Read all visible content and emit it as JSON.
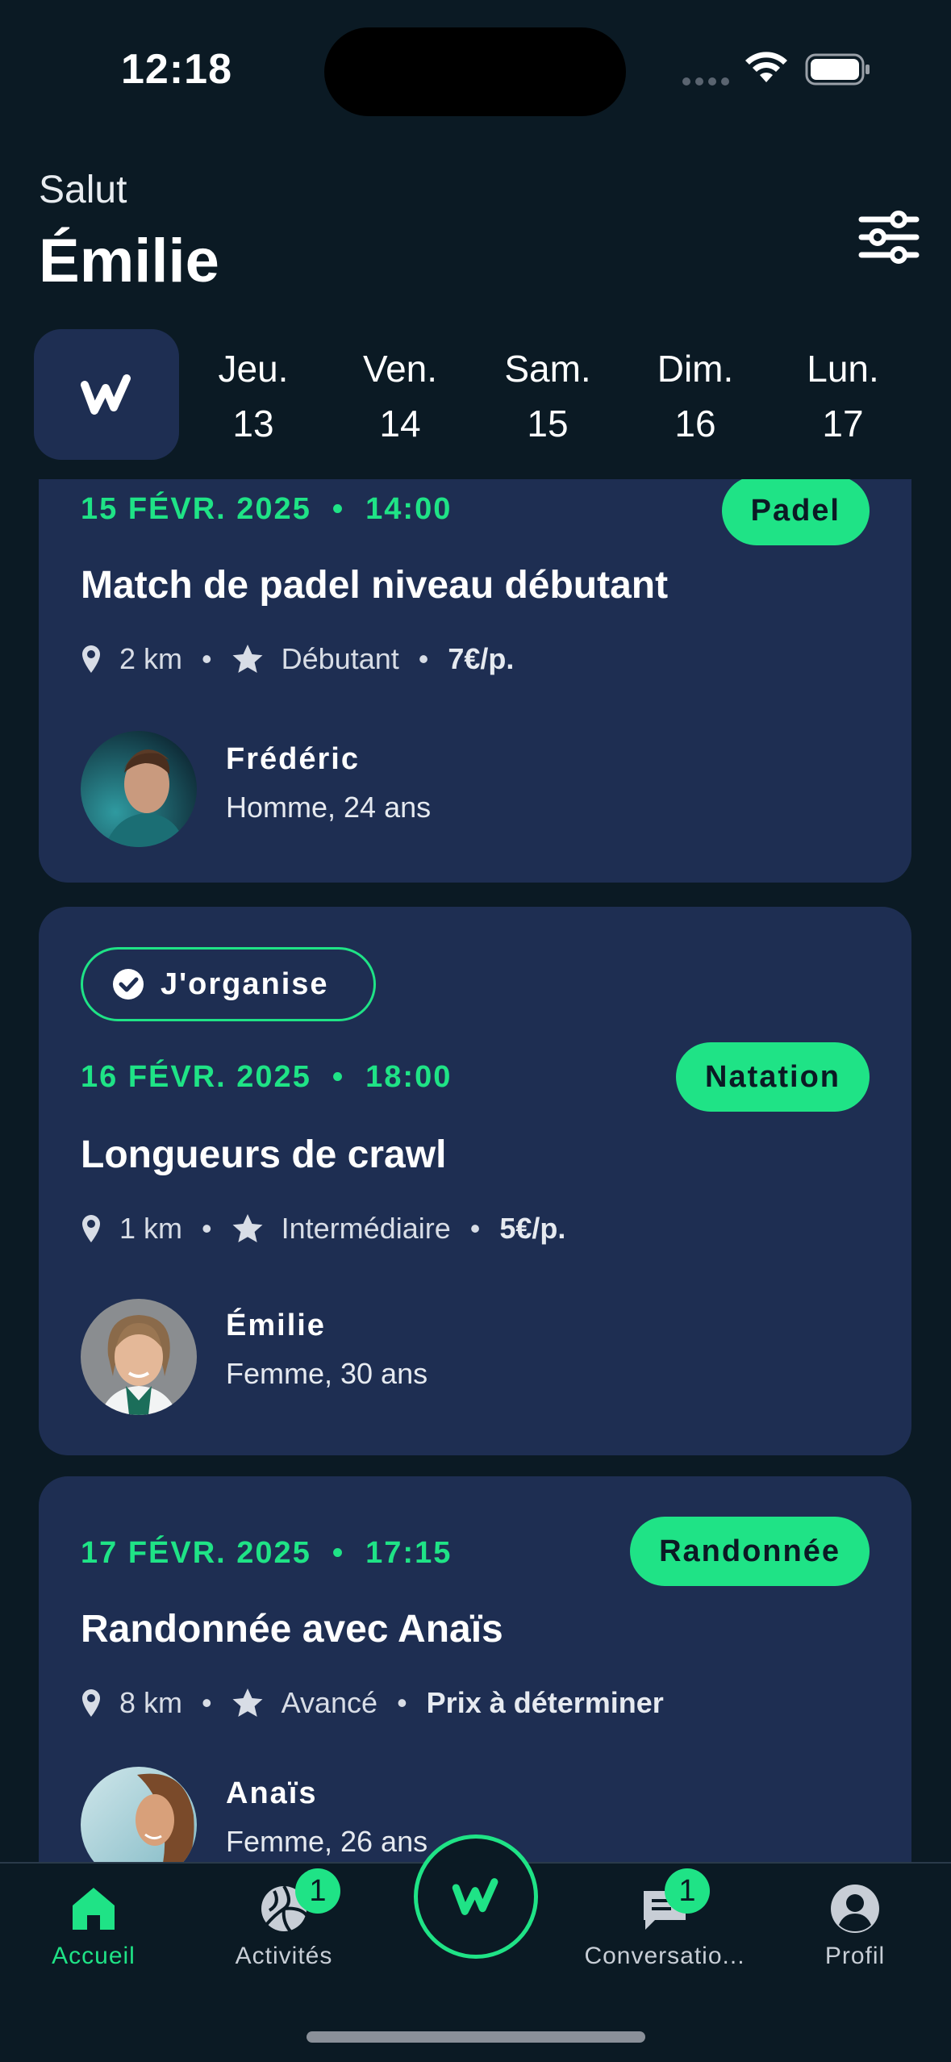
{
  "status_bar": {
    "time": "12:18"
  },
  "header": {
    "greeting": "Salut",
    "name": "Émilie"
  },
  "days": [
    {
      "name": "Jeu.",
      "num": "13"
    },
    {
      "name": "Ven.",
      "num": "14"
    },
    {
      "name": "Sam.",
      "num": "15"
    },
    {
      "name": "Dim.",
      "num": "16"
    },
    {
      "name": "Lun.",
      "num": "17"
    }
  ],
  "events": [
    {
      "date": "15 FÉVR. 2025",
      "time": "14:00",
      "sport": "Padel",
      "title": "Match de padel niveau débutant",
      "distance": "2 km",
      "level": "Débutant",
      "price": "7€/p.",
      "host_name": "Frédéric",
      "host_info": "Homme, 24 ans"
    },
    {
      "organiser_label": "J'organise",
      "date": "16 FÉVR. 2025",
      "time": "18:00",
      "sport": "Natation",
      "title": "Longueurs de crawl",
      "distance": "1 km",
      "level": "Intermédiaire",
      "price": "5€/p.",
      "host_name": "Émilie",
      "host_info": "Femme, 30 ans"
    },
    {
      "date": "17 FÉVR. 2025",
      "time": "17:15",
      "sport": "Randonnée",
      "title": "Randonnée avec Anaïs",
      "distance": "8 km",
      "level": "Avancé",
      "price": "Prix à déterminer",
      "host_name": "Anaïs",
      "host_info": "Femme, 26 ans"
    }
  ],
  "separators": {
    "datetime": "•",
    "meta": "•"
  },
  "tabs": [
    {
      "label": "Accueil",
      "icon": "home-icon",
      "active": true
    },
    {
      "label": "Activités",
      "icon": "volleyball-icon",
      "badge": "1"
    },
    {
      "label": "Conversatio...",
      "icon": "chat-icon",
      "badge": "1"
    },
    {
      "label": "Profil",
      "icon": "profile-icon"
    }
  ],
  "colors": {
    "accent": "#1fe386",
    "background": "#0b1a24",
    "card": "#1e2e52"
  }
}
